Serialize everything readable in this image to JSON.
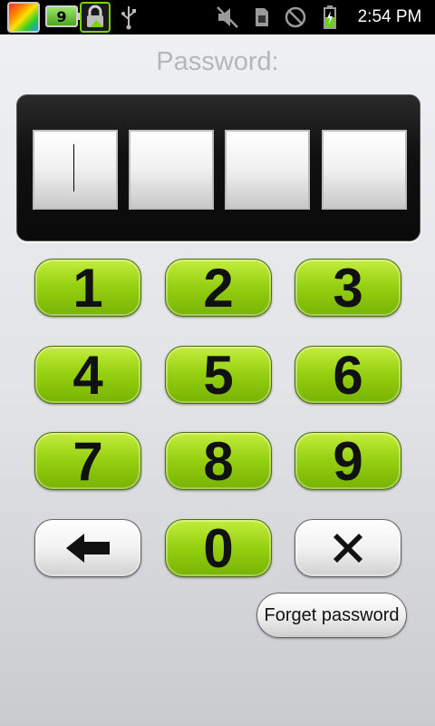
{
  "status_bar": {
    "time": "2:54 PM",
    "battery_widget_value": "9",
    "icons": [
      "app-icon",
      "battery-widget",
      "app-lock-icon",
      "usb-icon",
      "mute-icon",
      "sim-card-icon",
      "no-signal-icon",
      "battery-charging-icon"
    ]
  },
  "lock_screen": {
    "title": "Password:",
    "password_slots": 4,
    "keys": {
      "k1": "1",
      "k2": "2",
      "k3": "3",
      "k4": "4",
      "k5": "5",
      "k6": "6",
      "k7": "7",
      "k8": "8",
      "k9": "9",
      "k0": "0"
    },
    "backspace_icon": "left-arrow-icon",
    "clear_icon": "x-icon",
    "forget_label": "Forget password"
  },
  "colors": {
    "key_green": "#94cf10",
    "key_gray": "#e6e6e6",
    "panel": "#111111"
  }
}
